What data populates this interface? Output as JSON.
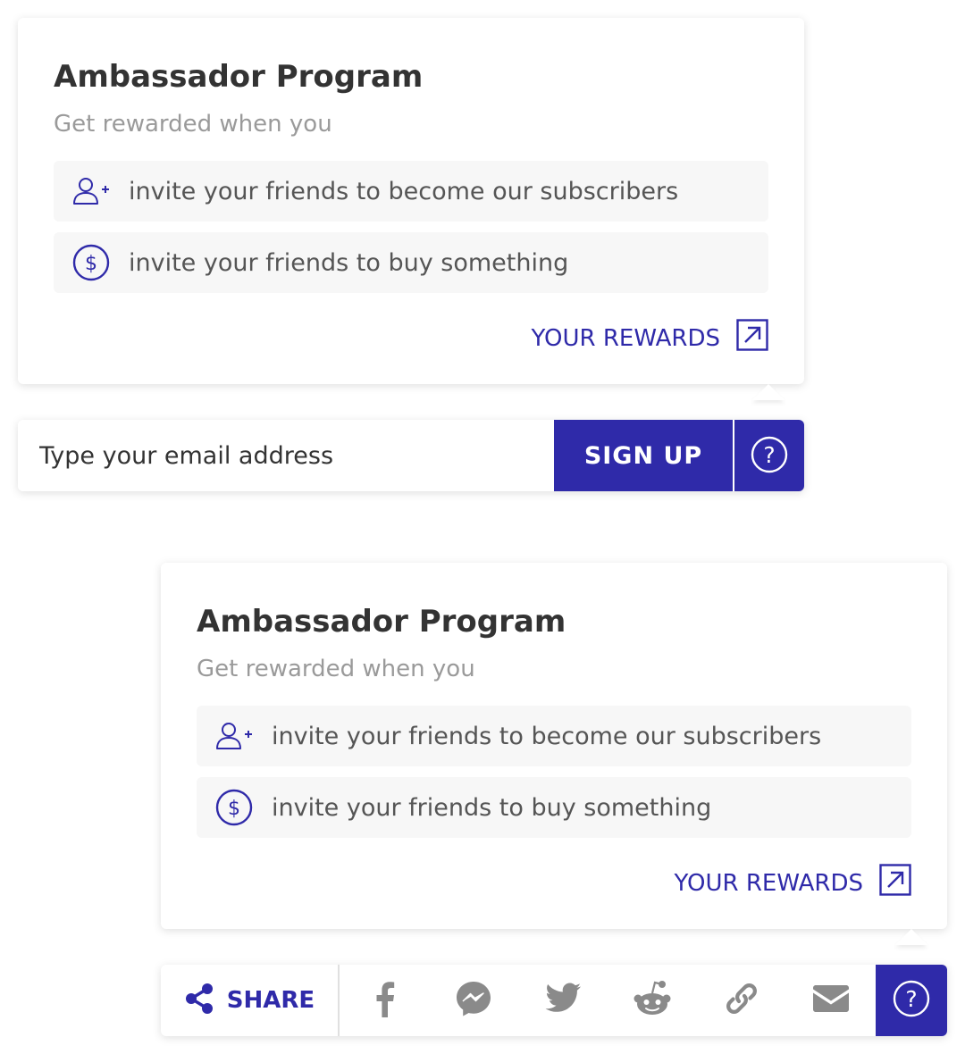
{
  "colors": {
    "accent": "#2f2aa9",
    "text": "#333333",
    "muted": "#9a9a9a",
    "item_bg": "#f7f7f7",
    "social_icon": "#8a8a8a"
  },
  "ambassador_card_top": {
    "title": "Ambassador Program",
    "subtitle": "Get rewarded when you",
    "items": [
      {
        "icon": "user-plus-icon",
        "text": "invite your friends to become our subscribers"
      },
      {
        "icon": "dollar-circle-icon",
        "text": "invite your friends to buy something"
      }
    ],
    "rewards_link": {
      "label": "YOUR REWARDS",
      "icon": "external-link-icon"
    }
  },
  "signup": {
    "email_placeholder": "Type your email address",
    "button_label": "SIGN UP",
    "help_icon": "question-circle-icon"
  },
  "ambassador_card_bottom": {
    "title": "Ambassador Program",
    "subtitle": "Get rewarded when you",
    "items": [
      {
        "icon": "user-plus-icon",
        "text": "invite your friends to become our subscribers"
      },
      {
        "icon": "dollar-circle-icon",
        "text": "invite your friends to buy something"
      }
    ],
    "rewards_link": {
      "label": "YOUR REWARDS",
      "icon": "external-link-icon"
    }
  },
  "share": {
    "label": "SHARE",
    "share_icon": "share-icon",
    "networks": [
      "facebook-icon",
      "messenger-icon",
      "twitter-icon",
      "reddit-icon",
      "link-icon",
      "email-icon"
    ],
    "help_icon": "question-circle-icon"
  }
}
